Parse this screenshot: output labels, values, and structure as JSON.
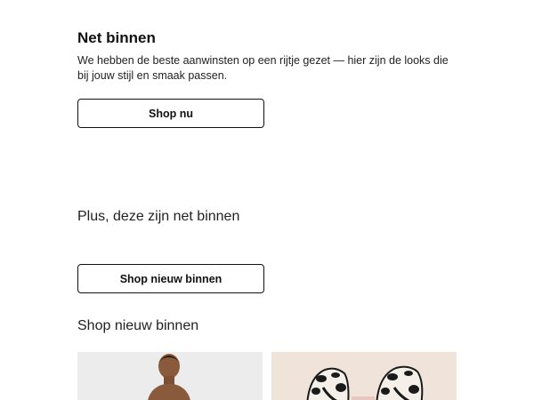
{
  "hero": {
    "title": "Net binnen",
    "text": "We hebben de beste aanwinsten op een rijtje gezet — hier zijn de looks die bij jouw stijl en smaak passen.",
    "button_label": "Shop nu"
  },
  "new_in": {
    "heading": "Plus, deze zijn net binnen",
    "button_label": "Shop nieuw binnen"
  },
  "shop_new": {
    "heading": "Shop nieuw binnen",
    "products": [
      {
        "image": "model-photo"
      },
      {
        "image": "animal-print-shoes-photo"
      }
    ]
  }
}
